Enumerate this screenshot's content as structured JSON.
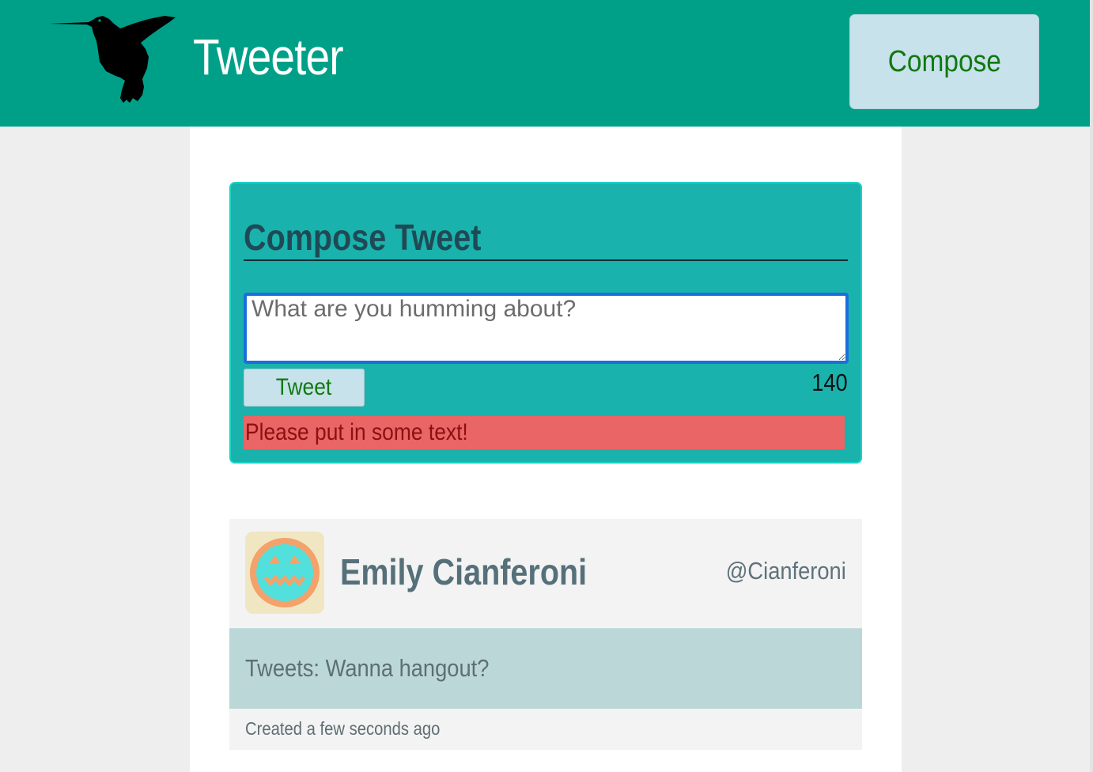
{
  "app": {
    "title": "Tweeter",
    "logo_icon": "hummingbird-icon",
    "accent_color": "#00a088"
  },
  "nav": {
    "compose_label": "Compose"
  },
  "compose": {
    "heading": "Compose Tweet",
    "input_value": "",
    "placeholder": "What are you humming about?",
    "submit_label": "Tweet",
    "char_count": "140",
    "error_message": "Please put in some text!"
  },
  "tweets": [
    {
      "author_name": "Emily Cianferoni",
      "handle": "@Cianferoni",
      "avatar_icon": "pumpkin-face-avatar",
      "text": "Tweets: Wanna hangout?",
      "created": "Created a few seconds ago"
    }
  ]
}
